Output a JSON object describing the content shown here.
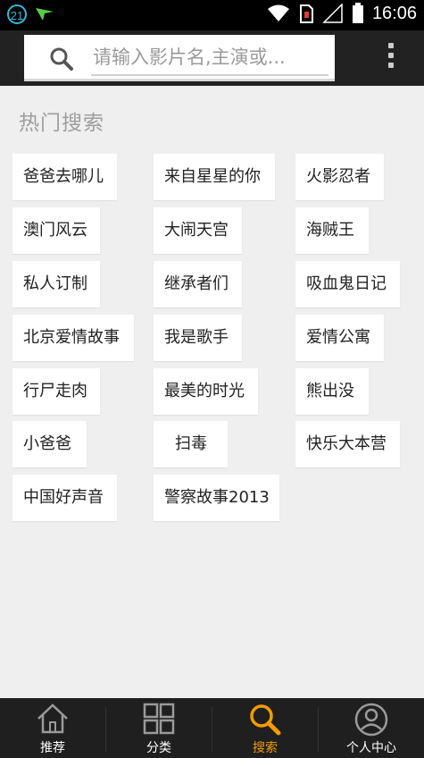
{
  "status_bar": {
    "notification_count": "21",
    "time": "16:06"
  },
  "search": {
    "placeholder": "请输入影片名,主演或..."
  },
  "hot_search": {
    "title": "热门搜索",
    "items": [
      "爸爸去哪儿",
      "来自星星的你",
      "火影忍者",
      "澳门风云",
      "大闹天宫",
      "海贼王",
      "私人订制",
      "继承者们",
      "吸血鬼日记",
      "北京爱情故事",
      "我是歌手",
      "爱情公寓",
      "行尸走肉",
      "最美的时光",
      "熊出没",
      "小爸爸",
      "扫毒",
      "快乐大本营",
      "中国好声音",
      "警察故事2013"
    ]
  },
  "bottom_nav": {
    "items": [
      {
        "label": "推荐",
        "icon": "home-icon"
      },
      {
        "label": "分类",
        "icon": "grid-icon"
      },
      {
        "label": "搜索",
        "icon": "search-icon"
      },
      {
        "label": "个人中心",
        "icon": "user-icon"
      }
    ],
    "active_index": 2,
    "active_color": "#f39c00"
  },
  "colors": {
    "header_bg": "#222222",
    "page_bg": "#efefef",
    "accent": "#f39c00"
  }
}
